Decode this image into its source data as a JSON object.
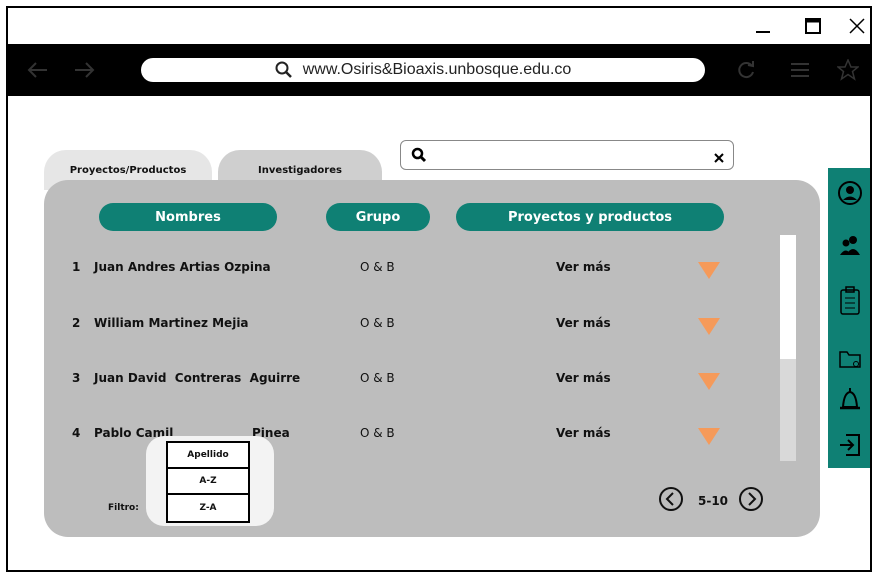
{
  "browser": {
    "url": "www.Osiris&Bioaxis.unbosque.edu.co",
    "icons": [
      "minimize-icon",
      "maximize-icon",
      "close-icon",
      "back-icon",
      "forward-icon",
      "search-icon",
      "reload-icon",
      "menu-icon",
      "star-icon"
    ]
  },
  "tabs": [
    {
      "label": "Proyectos/Productos"
    },
    {
      "label": "Investigadores"
    }
  ],
  "search": {
    "placeholder": ""
  },
  "table": {
    "headers": {
      "nombres": "Nombres",
      "grupo": "Grupo",
      "proyectos": "Proyectos y productos"
    },
    "rows": [
      {
        "num": "1",
        "name": "Juan Andres Artias Ozpina",
        "grupo": "O & B",
        "ver": "Ver más"
      },
      {
        "num": "2",
        "name": "William Martinez Mejia",
        "grupo": "O & B",
        "ver": "Ver más"
      },
      {
        "num": "3",
        "name": "Juan David  Contreras  Aguirre",
        "grupo": "O & B",
        "ver": "Ver más"
      },
      {
        "num": "4",
        "name": "Pablo Camil",
        "name_tail": "Pinea",
        "grupo": "O & B",
        "ver": "Ver más"
      }
    ]
  },
  "filter": {
    "label": "Filtro:",
    "options": [
      "Apellido",
      "A-Z",
      "Z-A"
    ]
  },
  "pagination": {
    "range": "5-10"
  },
  "colors": {
    "accent": "#0f8074",
    "panel": "#bdbdbd",
    "arrow": "#f59a5a"
  },
  "sidebar_icons": [
    "user-icon",
    "users-icon",
    "clipboard-icon",
    "folder-icon",
    "bell-icon",
    "logout-icon"
  ]
}
